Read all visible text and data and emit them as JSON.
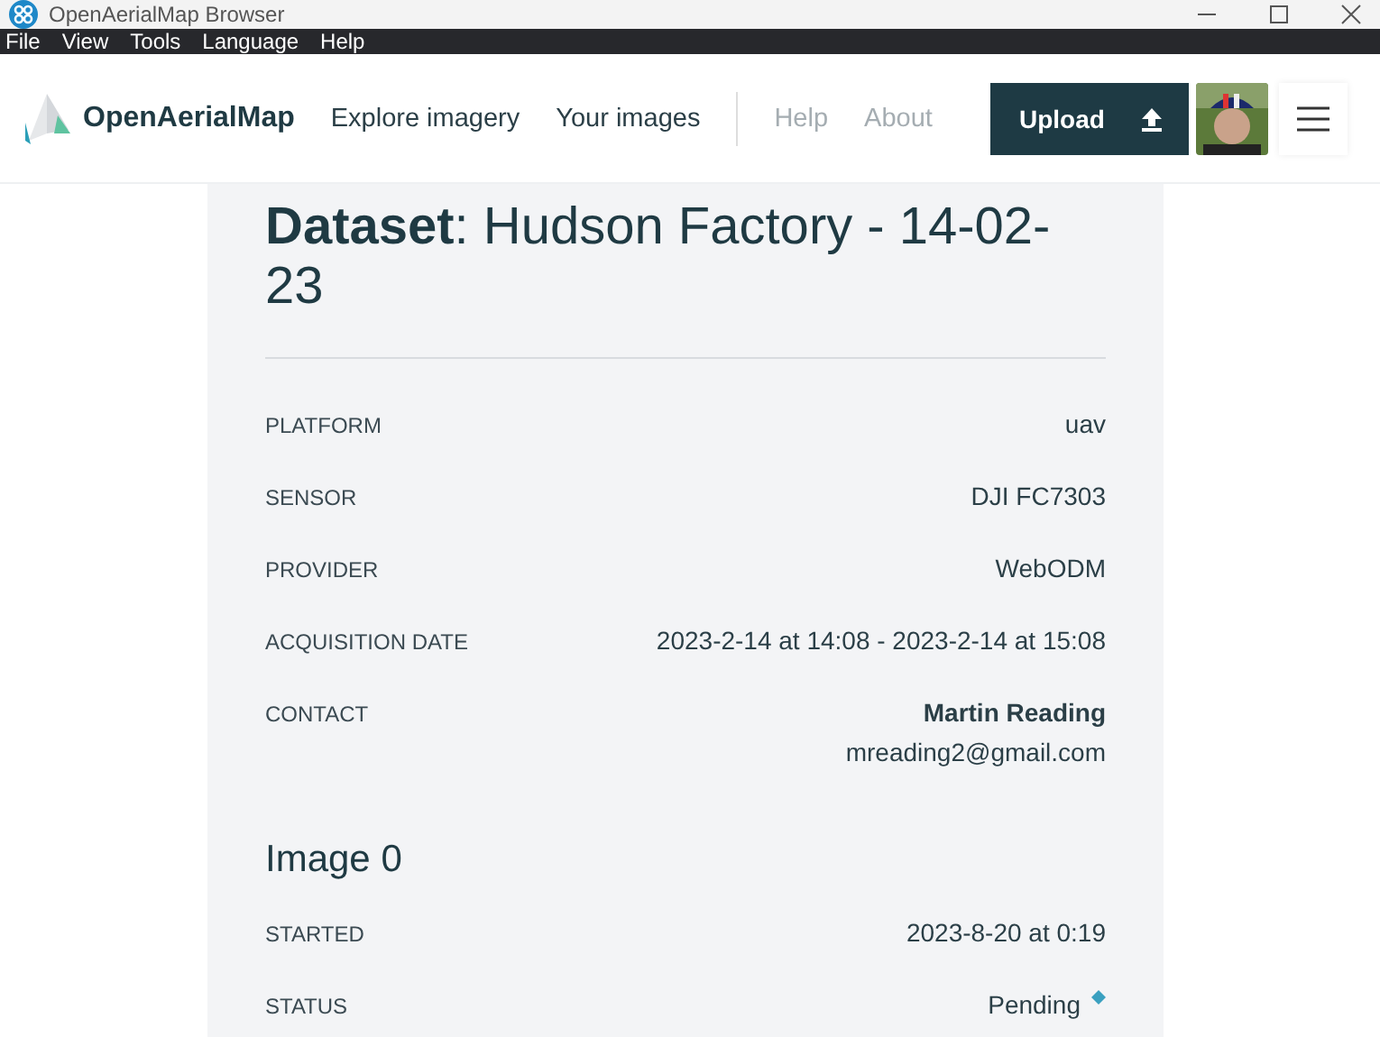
{
  "window": {
    "title": "OpenAerialMap Browser"
  },
  "menu_bar": [
    "File",
    "View",
    "Tools",
    "Language",
    "Help"
  ],
  "header": {
    "brand": "OpenAerialMap",
    "nav": [
      "Explore imagery",
      "Your images"
    ],
    "secondary_nav": [
      "Help",
      "About"
    ],
    "upload_button": "Upload"
  },
  "dataset": {
    "title": "**Dataset**: Hudson Factory - 14-02-23",
    "fields": [
      {
        "kind": "text",
        "label": "PLATFORM",
        "value": "uav"
      },
      {
        "kind": "text",
        "label": "SENSOR",
        "value": "DJI FC7303"
      },
      {
        "kind": "text",
        "label": "PROVIDER",
        "value": "WebODM"
      },
      {
        "kind": "text",
        "label": "ACQUISITION DATE",
        "value": "2023-2-14 at 14:08 - 2023-2-14 at 15:08"
      },
      {
        "kind": "contact",
        "label": "CONTACT",
        "name": "Martin Reading",
        "email": "mreading2@gmail.com"
      }
    ]
  },
  "image": {
    "title": "Image 0",
    "fields": [
      {
        "kind": "text",
        "label": "STARTED",
        "value": "2023-8-20 at 0:19"
      },
      {
        "kind": "status",
        "label": "STATUS",
        "value": "Pending"
      }
    ]
  }
}
